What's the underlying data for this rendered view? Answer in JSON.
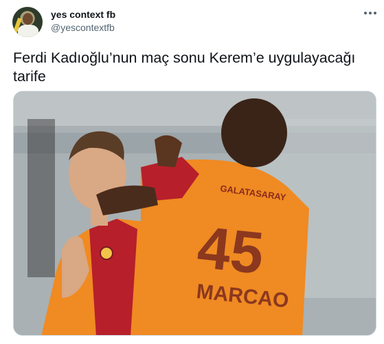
{
  "author": {
    "display_name": "yes context fb",
    "handle": "@yescontextfb"
  },
  "tweet": {
    "text": "Ferdi Kadıoğlu’nun maç sonu Kerem’e uygulayacağı tarife"
  },
  "media": {
    "jersey_number": "45",
    "jersey_name": "MARCAO",
    "jersey_sponsor": "GALATASARAY",
    "description_colors": {
      "orange": "#f08a22",
      "red": "#b71f2b",
      "background": "#a8b0b3"
    }
  }
}
